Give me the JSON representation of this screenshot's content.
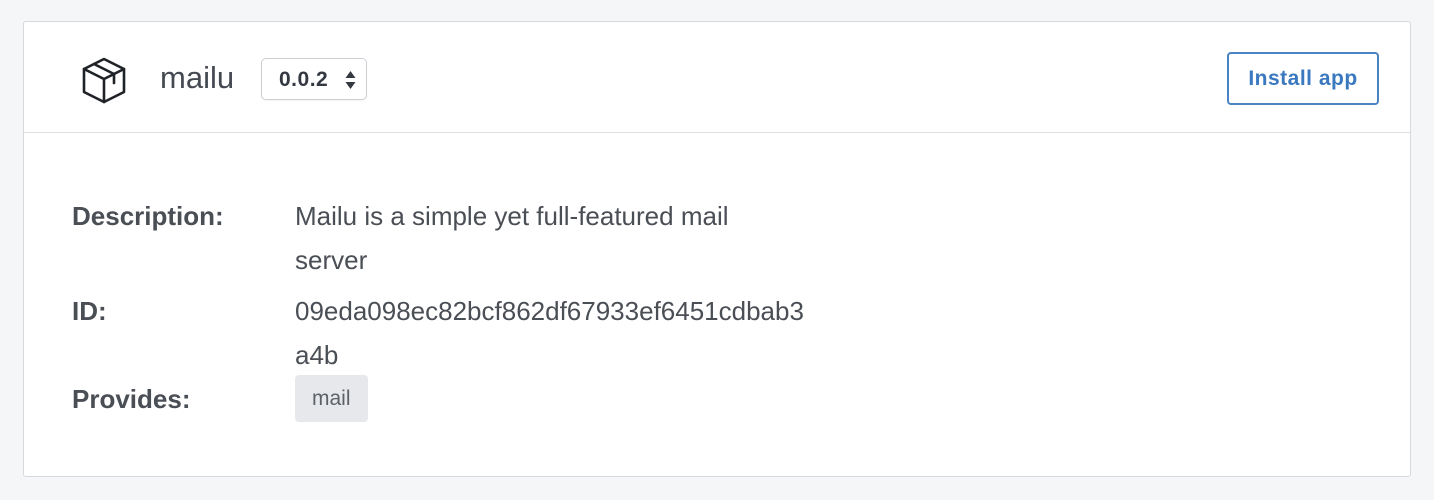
{
  "app": {
    "name": "mailu",
    "version": "0.0.2",
    "icon": "package-box-icon",
    "install_label": "Install app"
  },
  "details": {
    "description_label": "Description:",
    "description_value": "Mailu is a simple yet full-featured mail server",
    "id_label": "ID:",
    "id_value": "09eda098ec82bcf862df67933ef6451cdbab3a4b",
    "provides_label": "Provides:",
    "provides_tags": [
      "mail"
    ]
  },
  "colors": {
    "accent": "#3a78bf",
    "tag_bg": "#e6e8eb",
    "page_bg": "#f5f6f8"
  }
}
